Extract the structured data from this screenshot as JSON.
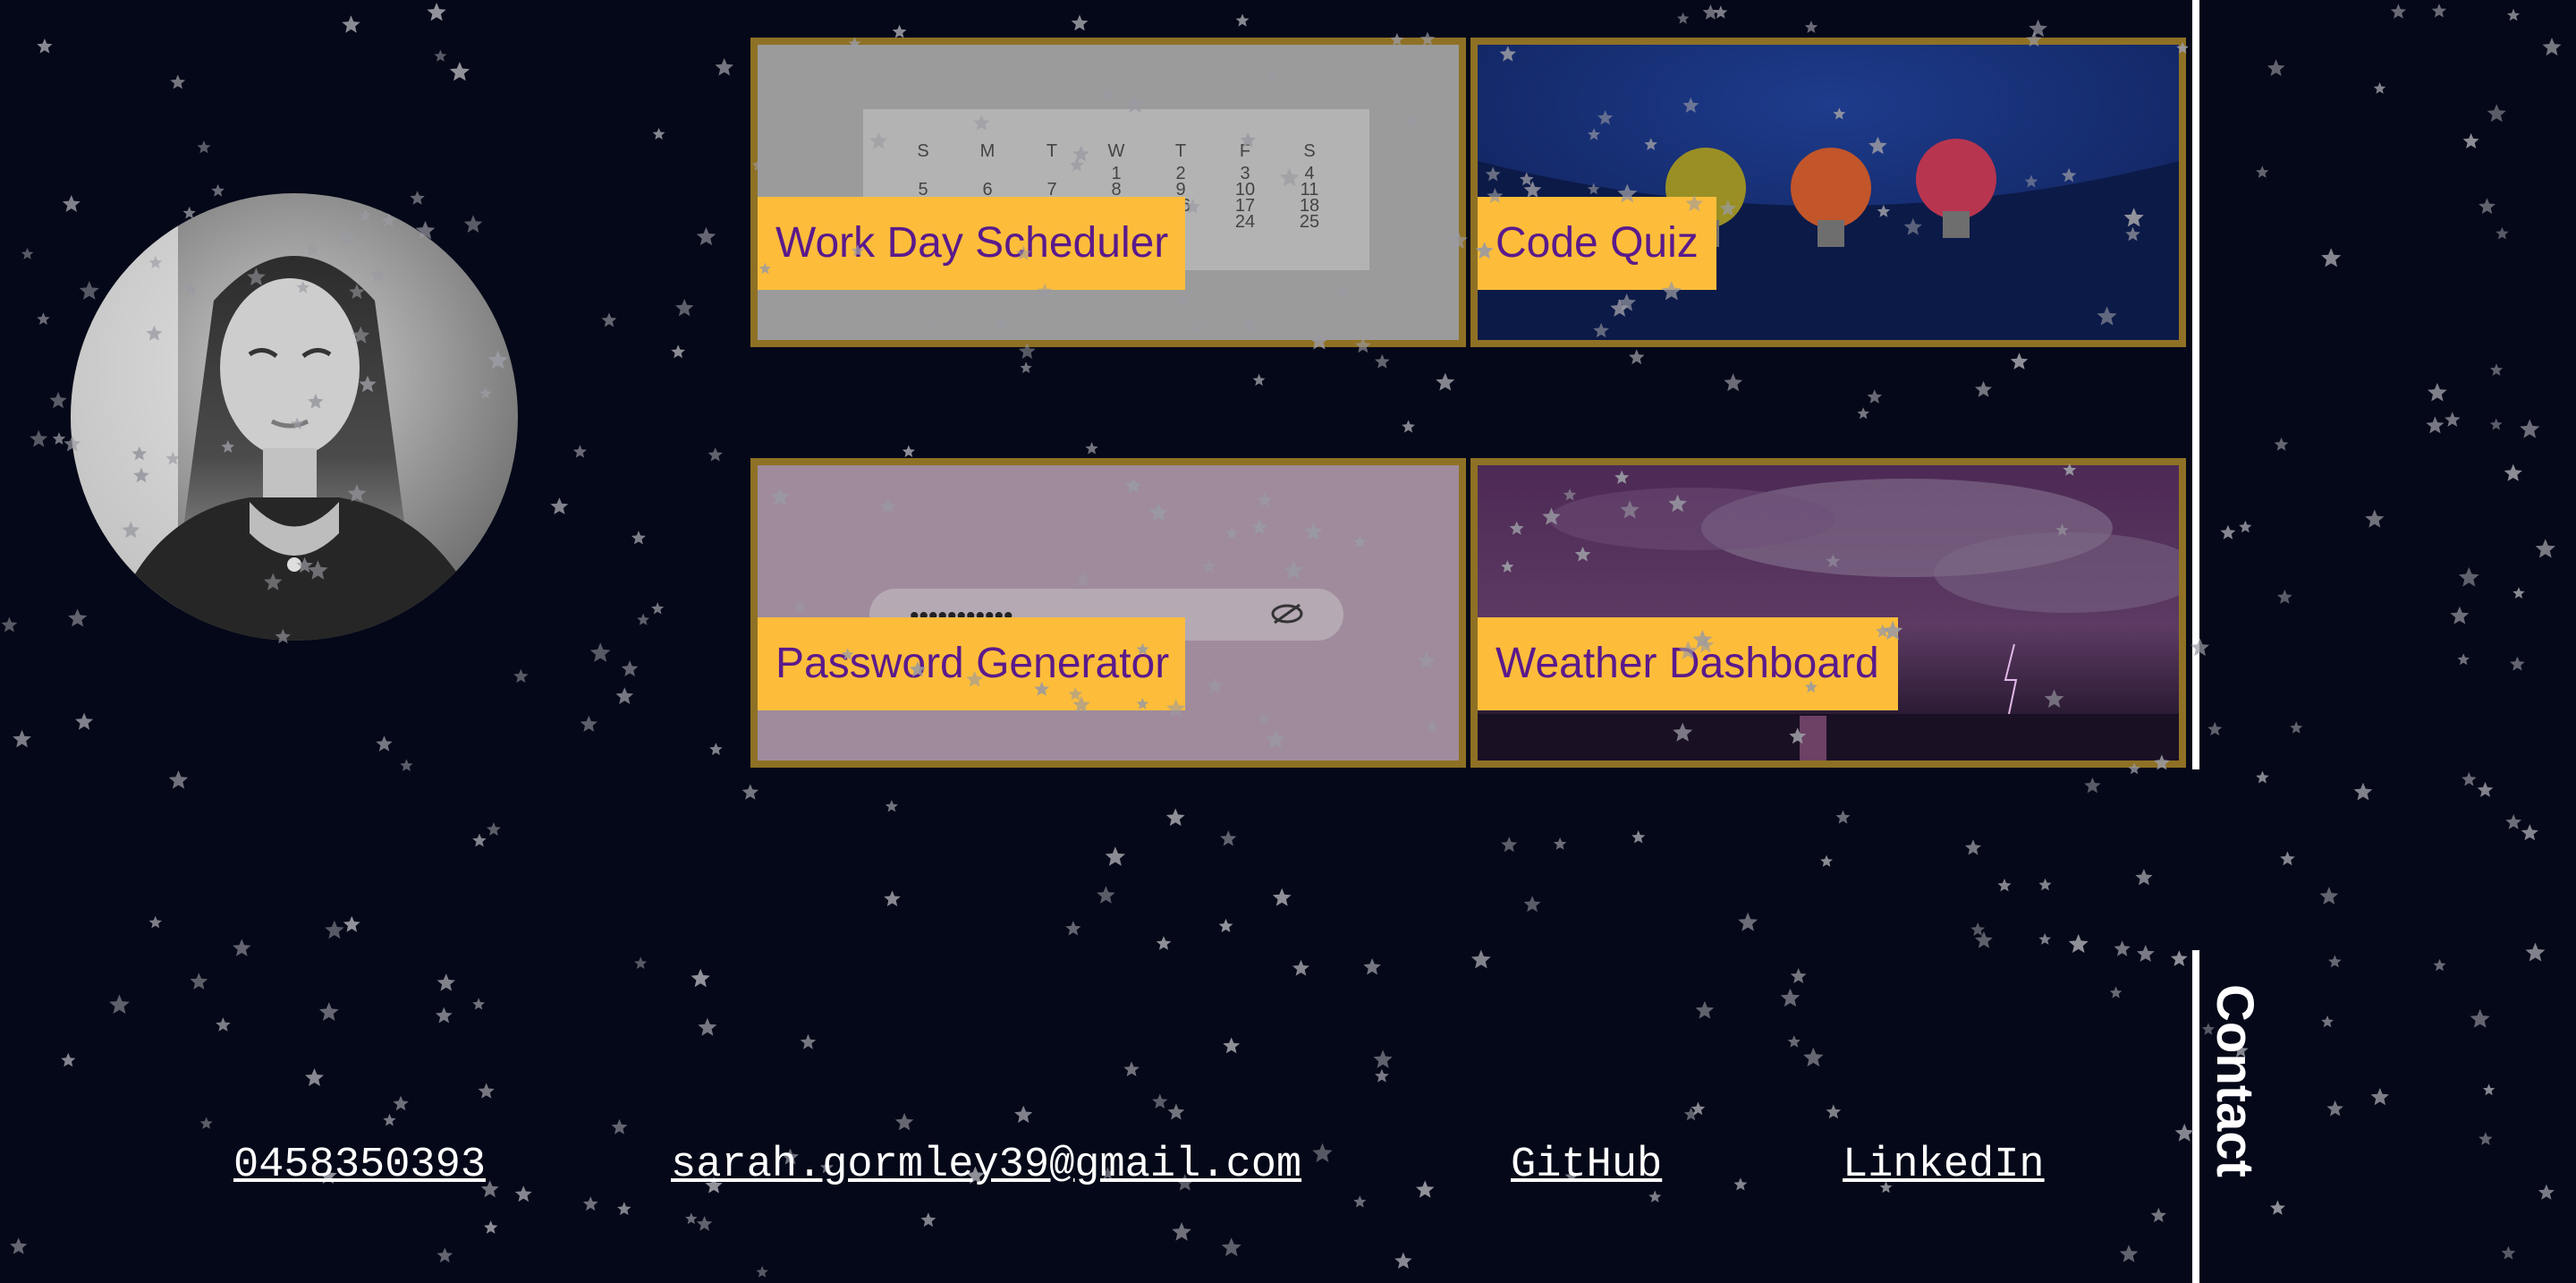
{
  "projects": [
    {
      "title": "Work Day Scheduler"
    },
    {
      "title": "Code Quiz"
    },
    {
      "title": "Password Generator"
    },
    {
      "title": "Weather Dashboard"
    }
  ],
  "contact": {
    "heading": "Contact",
    "phone": "0458350393",
    "email": "sarah.gormley39@gmail.com",
    "github": "GitHub",
    "linkedin": "LinkedIn"
  },
  "calendar": {
    "days": [
      "S",
      "M",
      "T",
      "W",
      "T",
      "F",
      "S"
    ],
    "row1": [
      "1",
      "2",
      "3",
      "4"
    ],
    "row2": [
      "5",
      "6",
      "7",
      "8",
      "9",
      "10",
      "11"
    ],
    "row3": [
      "16",
      "17",
      "18"
    ],
    "row4": [
      "24",
      "25"
    ]
  },
  "password_mask": "•••••••••••",
  "colors": {
    "background": "#040818",
    "card_border": "#8f7125",
    "label_bg": "#fdbd3a",
    "label_text": "#5a1a8c",
    "divider": "#ffffff"
  },
  "icons": {
    "eye": "eye-slash-icon",
    "bulbs": [
      "lightbulb-yellow-icon",
      "lightbulb-orange-icon",
      "lightbulb-red-icon"
    ]
  }
}
